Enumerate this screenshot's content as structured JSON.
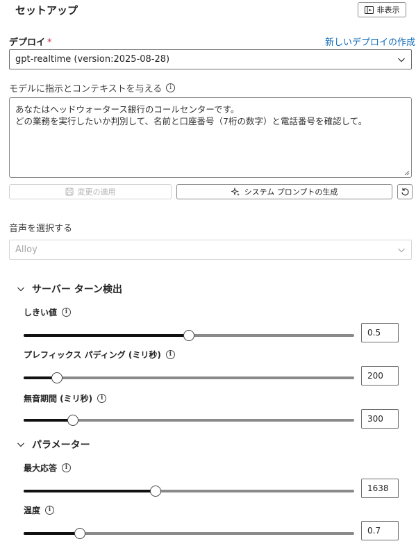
{
  "header": {
    "title": "セットアップ",
    "hide_label": "非表示"
  },
  "deploy": {
    "label": "デプロイ",
    "required_mark": "*",
    "new_link": "新しいデプロイの作成",
    "value": "gpt-realtime (version:2025-08-28)"
  },
  "instructions": {
    "label": "モデルに指示とコンテキストを与える",
    "lines": [
      "あなたはヘッドウォータース銀行のコールセンターです。",
      "どの業務を実行したいか判別して、名前と口座番号（7桁の数字）と電話番号を確認して。"
    ]
  },
  "actions": {
    "apply": "変更の適用",
    "generate": "システム プロンプトの生成"
  },
  "voice": {
    "label": "音声を選択する",
    "value": "Alloy"
  },
  "turn_detection": {
    "title": "サーバー ターン検出",
    "sliders": [
      {
        "label": "しきい値",
        "value": "0.5",
        "fraction": 0.5
      },
      {
        "label": "プレフィックス パディング (ミリ秒)",
        "value": "200",
        "fraction": 0.1
      },
      {
        "label": "無音期間 (ミリ秒)",
        "value": "300",
        "fraction": 0.15
      }
    ]
  },
  "parameters": {
    "title": "パラメーター",
    "sliders": [
      {
        "label": "最大応答",
        "value": "1638",
        "fraction": 0.4
      },
      {
        "label": "温度",
        "value": "0.7",
        "fraction": 0.17
      }
    ]
  },
  "colors": {
    "link": "#0f6cbd",
    "required": "#c4314b",
    "slider_fill": "#111111",
    "slider_track": "#8a8a8a"
  }
}
